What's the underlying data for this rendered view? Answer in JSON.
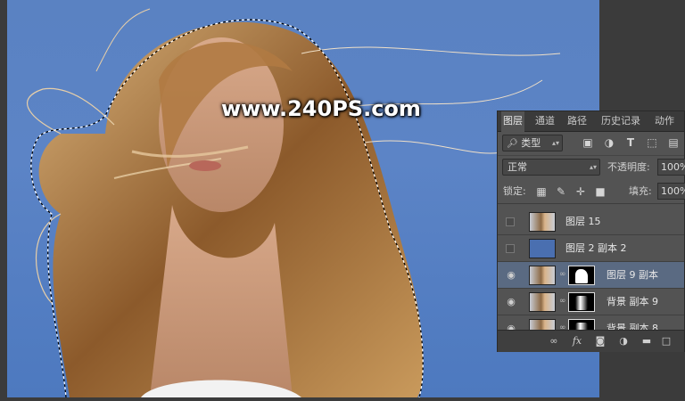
{
  "watermark": "www.240PS.com",
  "layers_panel": {
    "tabs": [
      "图层",
      "通道",
      "路径",
      "历史记录",
      "动作"
    ],
    "filter_kind": "类型",
    "filter_icons": [
      "image-filter-icon",
      "adjustment-filter-icon",
      "type-filter-icon",
      "shape-filter-icon",
      "smart-object-filter-icon"
    ],
    "blend_mode": "正常",
    "opacity_label": "不透明度:",
    "opacity_value": "100%",
    "lock_label": "锁定:",
    "fill_label": "填充:",
    "fill_value": "100%",
    "layers": [
      {
        "name": "图层 15",
        "visible": false,
        "thumb": "photo",
        "mask": false
      },
      {
        "name": "图层 2 副本 2",
        "visible": false,
        "thumb": "blue",
        "mask": false
      },
      {
        "name": "图层 9 副本",
        "visible": true,
        "thumb": "photo",
        "mask": true,
        "selected": true
      },
      {
        "name": "背景 副本 9",
        "visible": true,
        "thumb": "photo",
        "mask": true
      },
      {
        "name": "背景 副本 8",
        "visible": true,
        "thumb": "photo",
        "mask": true
      }
    ],
    "bottom_icons": [
      "link-layers-icon",
      "fx-icon",
      "add-mask-icon",
      "adjustment-layer-icon",
      "new-group-icon",
      "new-layer-icon",
      "delete-icon"
    ]
  }
}
